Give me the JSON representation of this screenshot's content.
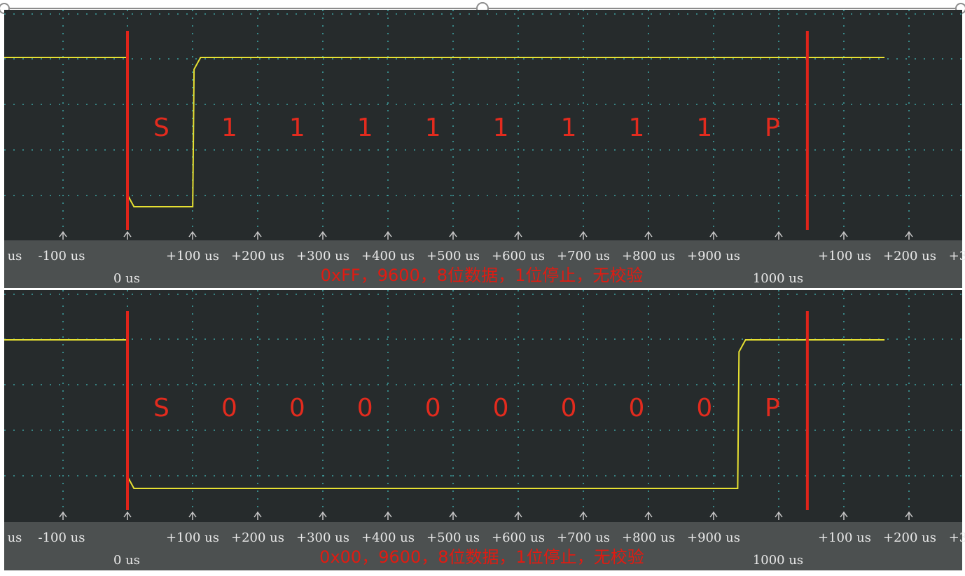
{
  "colors": {
    "background": "#262b2c",
    "axis_bar": "#4c5050",
    "grid_dot": "#3fa7a7",
    "signal": "#e6e032",
    "marker": "#e0241a",
    "label": "#e22b1e",
    "tick_text": "#e8e8e8"
  },
  "axis": {
    "unit": "us",
    "ticks_row1": [
      "us",
      "-100 us",
      "+100 us",
      "+200 us",
      "+300 us",
      "+400 us",
      "+500 us",
      "+600 us",
      "+700 us",
      "+800 us",
      "+900 us",
      "+100 us",
      "+200 us",
      "+3"
    ],
    "ticks_row2": [
      "0 us",
      "1000 us"
    ]
  },
  "chart_data": [
    {
      "type": "line",
      "title": "0xFF，9600，8位数据，1位停止，无校验",
      "x_unit": "us",
      "x": [
        -190,
        0,
        0,
        10,
        100,
        102,
        112,
        1160
      ],
      "y": [
        1,
        1,
        0.08,
        0,
        0,
        0.92,
        1,
        1
      ],
      "markers_us": [
        0,
        1041.7
      ],
      "bit_labels": [
        "S",
        "1",
        "1",
        "1",
        "1",
        "1",
        "1",
        "1",
        "1",
        "P"
      ],
      "bit_label_x_us": [
        52,
        156,
        260,
        364,
        468,
        572,
        676,
        780,
        884,
        988
      ]
    },
    {
      "type": "line",
      "title": "0x00，9600，8位数据，1位停止，无校验",
      "x_unit": "us",
      "x": [
        -190,
        0,
        0,
        10,
        935,
        937,
        947,
        1160
      ],
      "y": [
        1,
        1,
        0.08,
        0,
        0,
        0.92,
        1,
        1
      ],
      "markers_us": [
        0,
        1041.7
      ],
      "bit_labels": [
        "S",
        "0",
        "0",
        "0",
        "0",
        "0",
        "0",
        "0",
        "0",
        "P"
      ],
      "bit_label_x_us": [
        52,
        156,
        260,
        364,
        468,
        572,
        676,
        780,
        884,
        988
      ]
    }
  ]
}
